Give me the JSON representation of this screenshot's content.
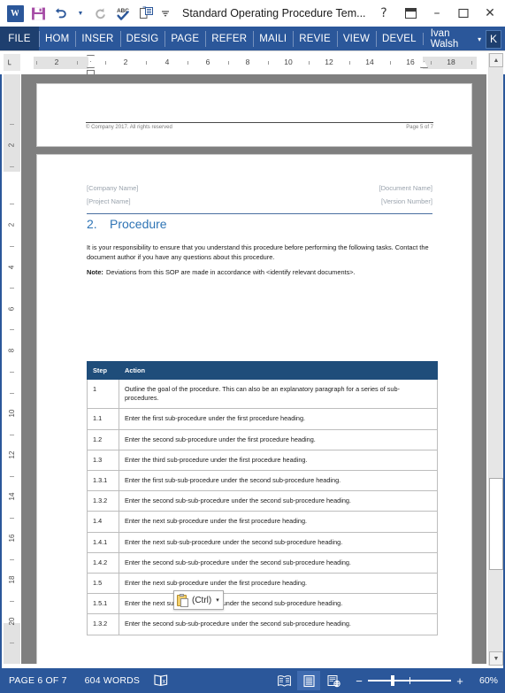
{
  "window": {
    "title": "Standard Operating Procedure Tem...",
    "qat": [
      {
        "name": "word-logo-icon",
        "label": "W"
      },
      {
        "name": "save-icon",
        "label": "Save"
      },
      {
        "name": "undo-icon",
        "label": "Undo"
      },
      {
        "name": "redo-icon",
        "label": "Redo"
      },
      {
        "name": "spelling-icon",
        "label": "Spelling & Grammar"
      },
      {
        "name": "print-preview-icon",
        "label": "Print Preview and Print"
      },
      {
        "name": "customize-qat-icon",
        "label": "Customize Quick Access Toolbar"
      }
    ],
    "help_label": "?",
    "ribbon_display_label": "⌷",
    "minimize_label": "–",
    "restore_label": "☐",
    "close_label": "✕"
  },
  "ribbon": {
    "file_tab": "FILE",
    "tabs": [
      "HOM",
      "INSER",
      "DESIG",
      "PAGE",
      "REFER",
      "MAILI",
      "REVIE",
      "VIEW",
      "DEVEL"
    ],
    "user_name": "Ivan Walsh",
    "user_caret": "▾",
    "avatar_initial": "K"
  },
  "rulers": {
    "corner_tab_stop": "└",
    "horizontal_numbers": [
      "2",
      "2",
      "4",
      "6",
      "8",
      "10",
      "12",
      "14",
      "16",
      "18"
    ],
    "vertical_numbers": [
      "2",
      "2",
      "4",
      "6",
      "8",
      "10",
      "12",
      "14",
      "16",
      "18",
      "20"
    ]
  },
  "document": {
    "previous_page": {
      "footer_left": "© Company 2017. All rights reserved",
      "footer_right": "Page 5 of 7"
    },
    "current_page": {
      "header_left_line1": "[Company Name]",
      "header_left_line2": "[Project Name]",
      "header_right_line1": "[Document Name]",
      "header_right_line2": "[Version Number]",
      "heading_number": "2.",
      "heading_text": "Procedure",
      "intro_paragraph": "It is your responsibility to ensure that you understand this procedure before performing the following tasks. Contact the document author if you have any questions about this procedure.",
      "note_label": "Note:",
      "note_text": "Deviations from this SOP are made in accordance with <identify relevant documents>."
    },
    "table": {
      "headers": [
        "Step",
        "Action"
      ],
      "rows": [
        {
          "step": "1",
          "action": "Outline the goal of the procedure. This can also be an explanatory paragraph for a series of sub-procedures."
        },
        {
          "step": "1.1",
          "action": "Enter the first sub-procedure under the first procedure heading."
        },
        {
          "step": "1.2",
          "action": "Enter the second sub-procedure under the first procedure heading."
        },
        {
          "step": "1.3",
          "action": "Enter the third sub-procedure under the first procedure heading."
        },
        {
          "step": "1.3.1",
          "action": "Enter the first sub-sub-procedure under the second sub-procedure heading."
        },
        {
          "step": "1.3.2",
          "action": "Enter the second sub-sub-procedure under the second sub-procedure heading."
        },
        {
          "step": "1.4",
          "action": "Enter the next sub-procedure under the first procedure heading."
        },
        {
          "step": "1.4.1",
          "action": "Enter the next sub-sub-procedure under the second sub-procedure heading."
        },
        {
          "step": "1.4.2",
          "action": "Enter the second sub-sub-procedure under the second sub-procedure heading."
        },
        {
          "step": "1.5",
          "action": "Enter the next sub-procedure under the first procedure heading."
        },
        {
          "step": "1.5.1",
          "action": "Enter the next sub-sub-procedure under the second sub-procedure heading."
        },
        {
          "step": "1.3.2",
          "action": "Enter the second sub-sub-procedure under the second sub-procedure heading."
        }
      ]
    }
  },
  "paste_popup": {
    "icon_name": "paste-options-clipboard-icon",
    "label": "(Ctrl)",
    "caret": "▾"
  },
  "scrollbar": {
    "up_arrow": "▲",
    "down_arrow": "▼"
  },
  "statusbar": {
    "page_status": "PAGE 6 OF 7",
    "word_count": "604 WORDS",
    "proofing_icon_name": "proofing-errors-icon",
    "views": [
      {
        "name": "read-mode-view-button",
        "label": "Read Mode",
        "active": false
      },
      {
        "name": "print-layout-view-button",
        "label": "Print Layout",
        "active": true
      },
      {
        "name": "web-layout-view-button",
        "label": "Web Layout",
        "active": false
      }
    ],
    "zoom_out_label": "−",
    "zoom_in_label": "+",
    "zoom_percent": "60%"
  },
  "colors": {
    "ribbon_blue": "#2b579a",
    "file_tab_blue": "#1e3f6f",
    "table_header_blue": "#1f4d7a",
    "heading_blue": "#2e74b5",
    "canvas_gray": "#7f7f7f"
  }
}
